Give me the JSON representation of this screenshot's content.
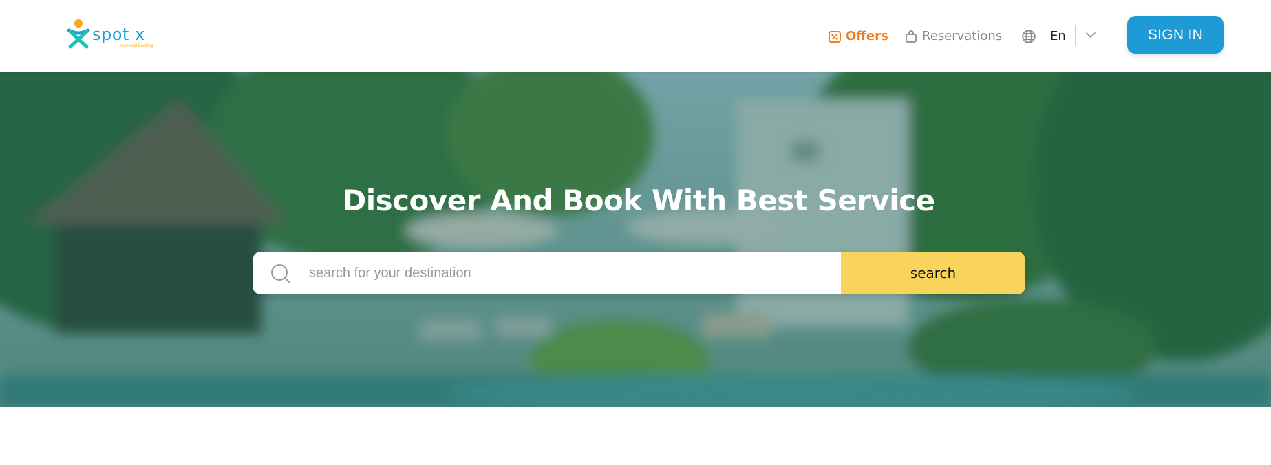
{
  "header": {
    "logo": {
      "word": "spot x",
      "tagline": "Your next Booking"
    },
    "nav": {
      "offers_label": "Offers",
      "reservations_label": "Reservations",
      "language_label": "En"
    },
    "signin_label": "SIGN IN"
  },
  "hero": {
    "title": "Discover And Book With Best Service",
    "search": {
      "placeholder": "search for your destination",
      "button_label": "search"
    }
  },
  "colors": {
    "brand_blue": "#1e9bd7",
    "offers_orange": "#f07d1e",
    "search_yellow": "#f9d45c"
  },
  "icons": [
    "logo-mark",
    "offers-tag-icon",
    "reservations-bag-icon",
    "globe-icon",
    "chevron-down-icon",
    "search-icon"
  ]
}
